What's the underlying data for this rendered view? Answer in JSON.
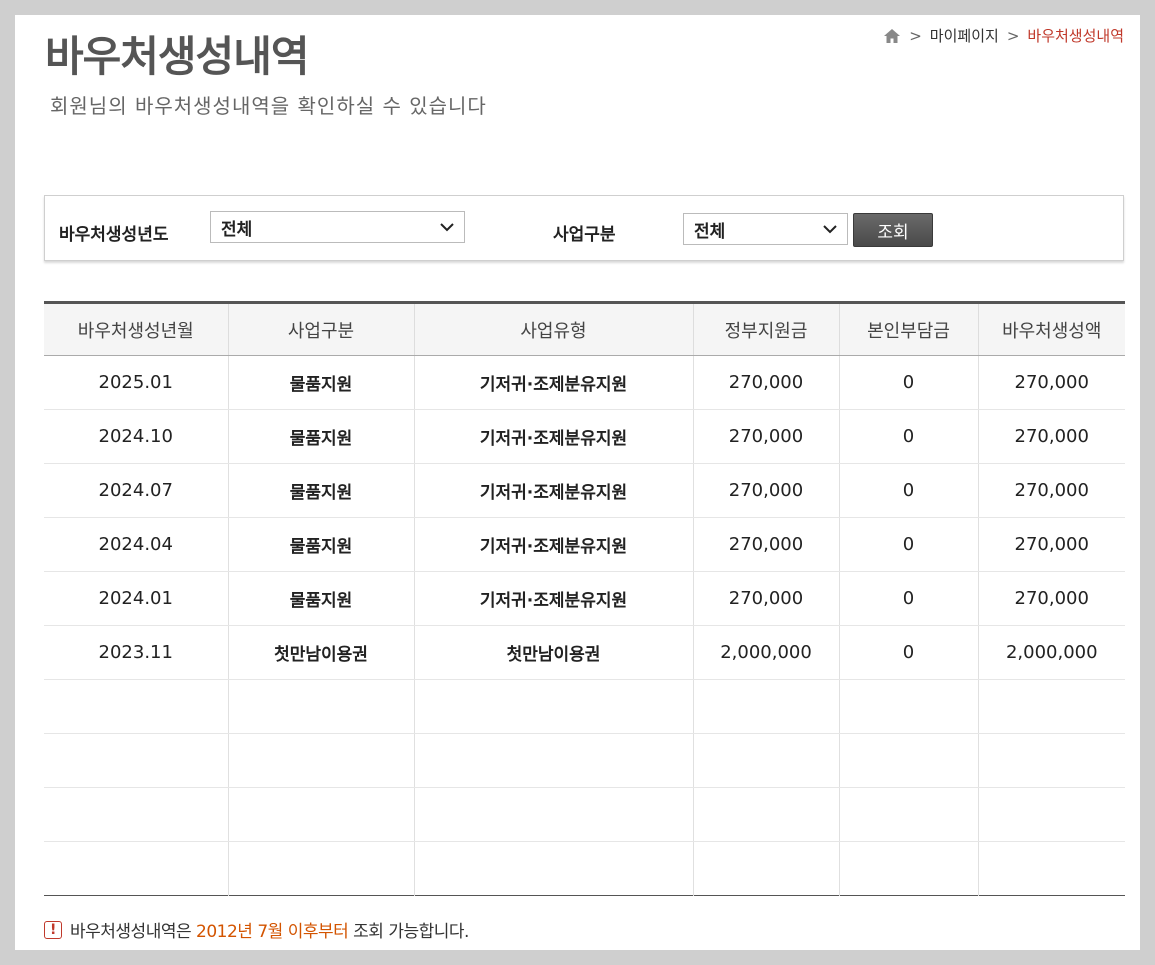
{
  "page": {
    "title": "바우처생성내역",
    "subtitle": "회원님의 바우처생성내역을 확인하실 수 있습니다"
  },
  "breadcrumb": {
    "home_icon": "home-icon",
    "items": [
      "마이페이지",
      "바우처생성내역"
    ]
  },
  "filters": {
    "year_label": "바우처생성년도",
    "year_selected": "전체",
    "business_label": "사업구분",
    "business_selected": "전체",
    "search_label": "조회"
  },
  "table": {
    "headers": [
      "바우처생성년월",
      "사업구분",
      "사업유형",
      "정부지원금",
      "본인부담금",
      "바우처생성액"
    ],
    "rows": [
      [
        "2025.01",
        "물품지원",
        "기저귀·조제분유지원",
        "270,000",
        "0",
        "270,000"
      ],
      [
        "2024.10",
        "물품지원",
        "기저귀·조제분유지원",
        "270,000",
        "0",
        "270,000"
      ],
      [
        "2024.07",
        "물품지원",
        "기저귀·조제분유지원",
        "270,000",
        "0",
        "270,000"
      ],
      [
        "2024.04",
        "물품지원",
        "기저귀·조제분유지원",
        "270,000",
        "0",
        "270,000"
      ],
      [
        "2024.01",
        "물품지원",
        "기저귀·조제분유지원",
        "270,000",
        "0",
        "270,000"
      ],
      [
        "2023.11",
        "첫만남이용권",
        "첫만남이용권",
        "2,000,000",
        "0",
        "2,000,000"
      ]
    ],
    "empty_rows": 4
  },
  "notice": {
    "prefix": "바우처생성내역은 ",
    "highlight": "2012년 7월 이후부터",
    "suffix": " 조회 가능합니다."
  },
  "colors": {
    "breadcrumb_current": "#c0392b",
    "notice_highlight": "#d35400"
  }
}
